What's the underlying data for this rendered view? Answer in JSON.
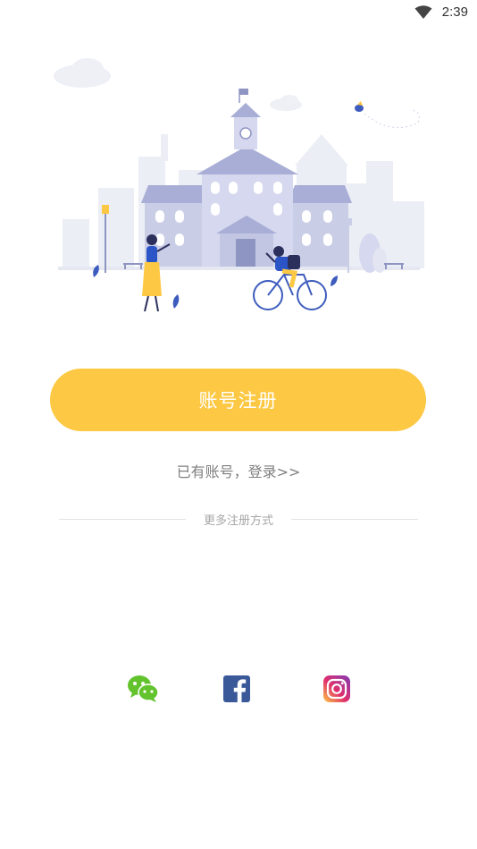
{
  "status_bar": {
    "time": "2:39",
    "wifi_icon": "wifi-icon"
  },
  "illustration": {
    "name": "campus-illustration"
  },
  "register": {
    "label": "账号注册",
    "color": "#fdc843"
  },
  "login": {
    "label": "已有账号，登录>>"
  },
  "divider": {
    "label": "更多注册方式"
  },
  "social": [
    {
      "name": "wechat",
      "icon": "wechat-icon",
      "color": "#62c32d"
    },
    {
      "name": "facebook",
      "icon": "facebook-icon",
      "color": "#3b5998"
    },
    {
      "name": "instagram",
      "icon": "instagram-icon",
      "color": "#c13584"
    }
  ]
}
